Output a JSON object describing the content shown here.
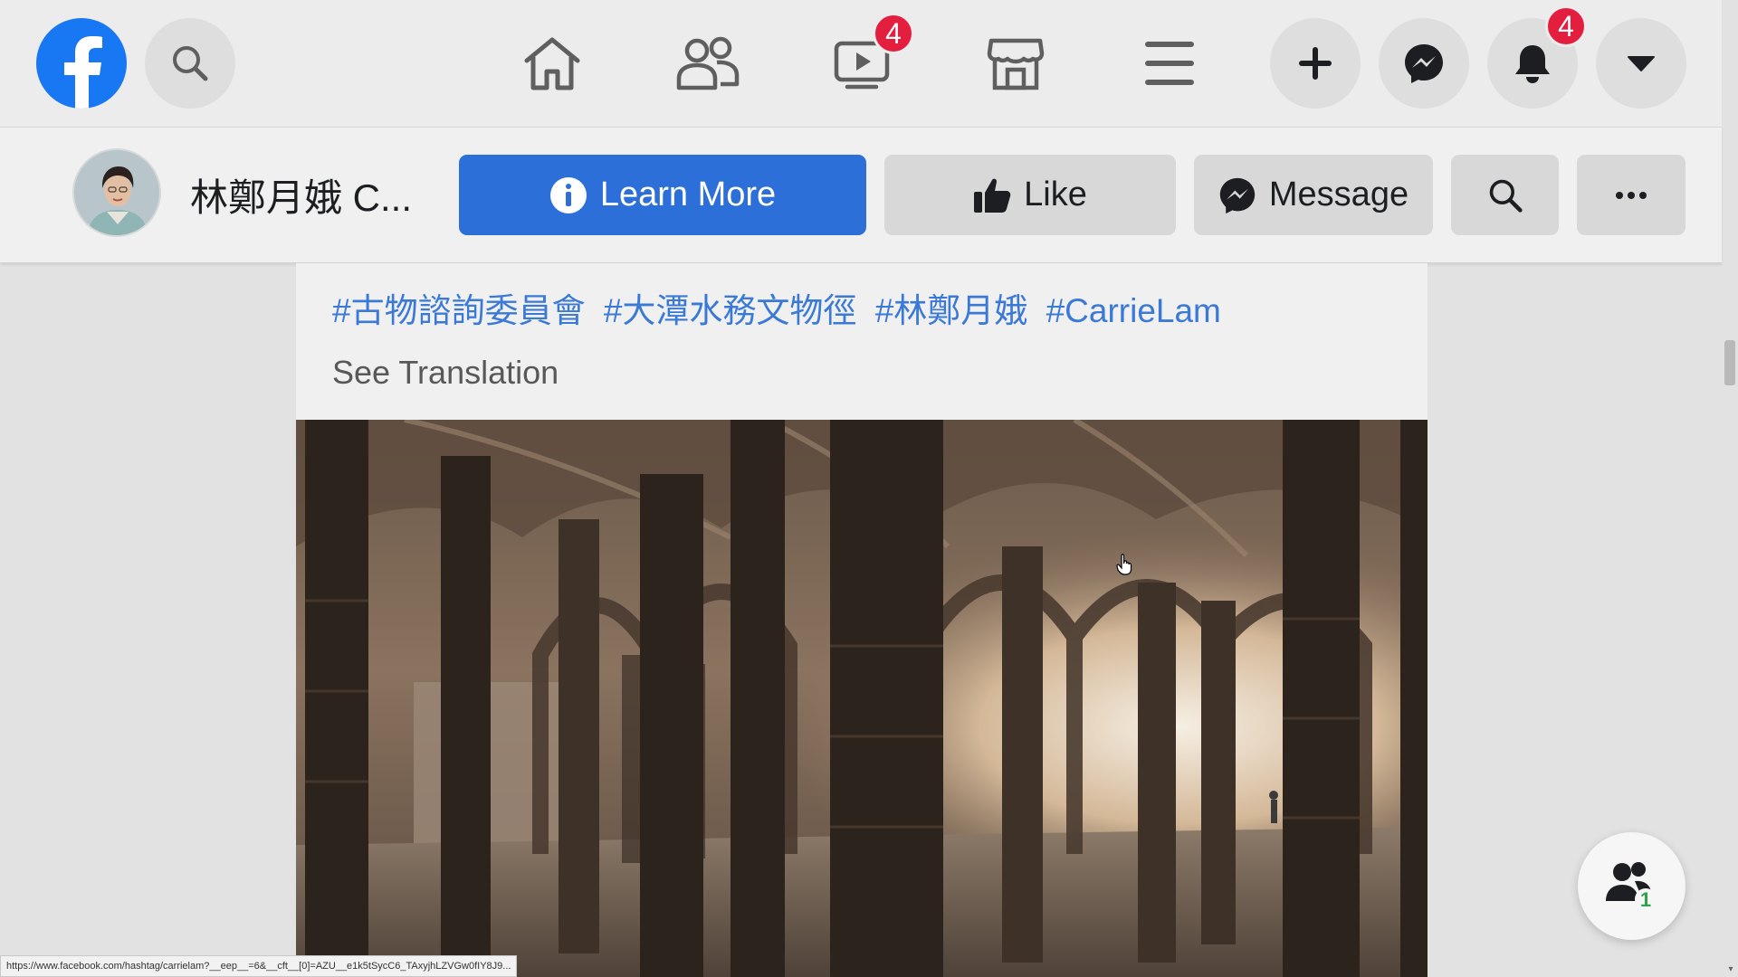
{
  "nav": {
    "watch_badge": "4",
    "notifications_badge": "4"
  },
  "page": {
    "name": "林鄭月娥 C...",
    "buttons": {
      "learn_more": "Learn More",
      "like": "Like",
      "message": "Message"
    }
  },
  "post": {
    "hashtags": [
      "#古物諮詢委員會",
      "#大潭水務文物徑",
      "#林鄭月娥",
      "#CarrieLam"
    ],
    "see_translation": "See Translation"
  },
  "contacts": {
    "count": "1"
  },
  "status_bar": {
    "url": "https://www.facebook.com/hashtag/carrielam?__eep__=6&__cft__[0]=AZU__e1k5tSycC6_TAxyjhLZVGw0fIY8J9..."
  },
  "colors": {
    "brand": "#1877f2",
    "primary_button": "#2d6fd9",
    "hashtag": "#3a79d6",
    "badge": "#e41e3f"
  }
}
